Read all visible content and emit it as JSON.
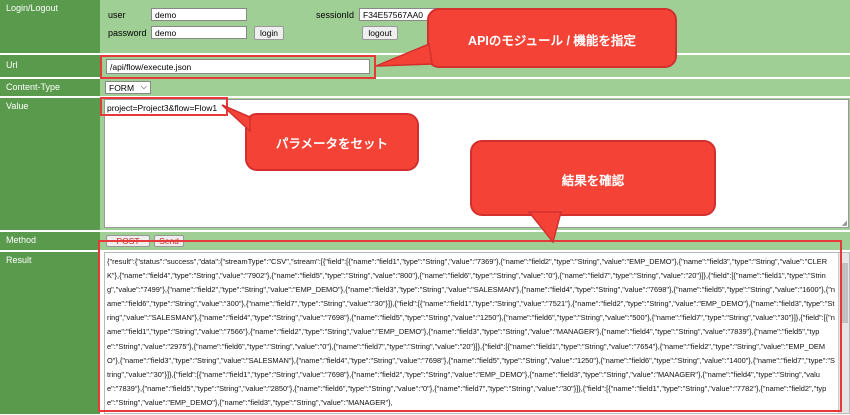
{
  "labels": {
    "login": "Login/Logout",
    "url": "Url",
    "content_type": "Content-Type",
    "value": "Value",
    "method": "Method",
    "result": "Result"
  },
  "login": {
    "user_label": "user",
    "user_value": "demo",
    "password_label": "password",
    "password_value": "demo",
    "login_button": "login",
    "sessionid_label": "sessionId",
    "sessionid_value": "F34E57567AA0",
    "logout_button": "logout"
  },
  "url": {
    "value": "/api/flow/execute.json"
  },
  "content_type": {
    "selected": "FORM",
    "chevron": "chevron-down-icon"
  },
  "value_field": {
    "value": "project=Project3&flow=Flow1"
  },
  "method": {
    "post_label": "POST",
    "send_label": "Send"
  },
  "result": {
    "text": "{\"result\":{\"status\":\"success\",\"data\":{\"streamType\":\"CSV\",\"stream\":[{\"field\":[{\"name\":\"field1\",\"type\":\"String\",\"value\":\"7369\"},{\"name\":\"field2\",\"type\":\"String\",\"value\":\"EMP_DEMO\"},{\"name\":\"field3\",\"type\":\"String\",\"value\":\"CLERK\"},{\"name\":\"field4\",\"type\":\"String\",\"value\":\"7902\"},{\"name\":\"field5\",\"type\":\"String\",\"value\":\"800\"},{\"name\":\"field6\",\"type\":\"String\",\"value\":\"0\"},{\"name\":\"field7\",\"type\":\"String\",\"value\":\"20\"}]},{\"field\":[{\"name\":\"field1\",\"type\":\"String\",\"value\":\"7499\"},{\"name\":\"field2\",\"type\":\"String\",\"value\":\"EMP_DEMO\"},{\"name\":\"field3\",\"type\":\"String\",\"value\":\"SALESMAN\"},{\"name\":\"field4\",\"type\":\"String\",\"value\":\"7698\"},{\"name\":\"field5\",\"type\":\"String\",\"value\":\"1600\"},{\"name\":\"field6\",\"type\":\"String\",\"value\":\"300\"},{\"name\":\"field7\",\"type\":\"String\",\"value\":\"30\"}]},{\"field\":[{\"name\":\"field1\",\"type\":\"String\",\"value\":\"7521\"},{\"name\":\"field2\",\"type\":\"String\",\"value\":\"EMP_DEMO\"},{\"name\":\"field3\",\"type\":\"String\",\"value\":\"SALESMAN\"},{\"name\":\"field4\",\"type\":\"String\",\"value\":\"7698\"},{\"name\":\"field5\",\"type\":\"String\",\"value\":\"1250\"},{\"name\":\"field6\",\"type\":\"String\",\"value\":\"500\"},{\"name\":\"field7\",\"type\":\"String\",\"value\":\"30\"}]},{\"field\":[{\"name\":\"field1\",\"type\":\"String\",\"value\":\"7566\"},{\"name\":\"field2\",\"type\":\"String\",\"value\":\"EMP_DEMO\"},{\"name\":\"field3\",\"type\":\"String\",\"value\":\"MANAGER\"},{\"name\":\"field4\",\"type\":\"String\",\"value\":\"7839\"},{\"name\":\"field5\",\"type\":\"String\",\"value\":\"2975\"},{\"name\":\"field6\",\"type\":\"String\",\"value\":\"0\"},{\"name\":\"field7\",\"type\":\"String\",\"value\":\"20\"}]},{\"field\":[{\"name\":\"field1\",\"type\":\"String\",\"value\":\"7654\"},{\"name\":\"field2\",\"type\":\"String\",\"value\":\"EMP_DEMO\"},{\"name\":\"field3\",\"type\":\"String\",\"value\":\"SALESMAN\"},{\"name\":\"field4\",\"type\":\"String\",\"value\":\"7698\"},{\"name\":\"field5\",\"type\":\"String\",\"value\":\"1250\"},{\"name\":\"field6\",\"type\":\"String\",\"value\":\"1400\"},{\"name\":\"field7\",\"type\":\"String\",\"value\":\"30\"}]},{\"field\":[{\"name\":\"field1\",\"type\":\"String\",\"value\":\"7698\"},{\"name\":\"field2\",\"type\":\"String\",\"value\":\"EMP_DEMO\"},{\"name\":\"field3\",\"type\":\"String\",\"value\":\"MANAGER\"},{\"name\":\"field4\",\"type\":\"String\",\"value\":\"7839\"},{\"name\":\"field5\",\"type\":\"String\",\"value\":\"2850\"},{\"name\":\"field6\",\"type\":\"String\",\"value\":\"0\"},{\"name\":\"field7\",\"type\":\"String\",\"value\":\"30\"}]},{\"field\":[{\"name\":\"field1\",\"type\":\"String\",\"value\":\"7782\"},{\"name\":\"field2\",\"type\":\"String\",\"value\":\"EMP_DEMO\"},{\"name\":\"field3\",\"type\":\"String\",\"value\":\"MANAGER\"},"
  },
  "annotations": {
    "api_module": "APIのモジュール / 機能を指定",
    "set_params": "パラメータをセット",
    "check_result": "結果を確認"
  },
  "colors": {
    "label_bg": "#5a9a4d",
    "row_bg": "#9fcf95",
    "callout": "#f44336",
    "highlight": "#e5393a"
  }
}
